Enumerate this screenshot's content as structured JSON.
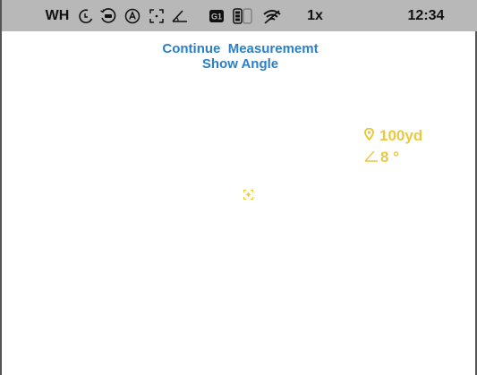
{
  "status_bar": {
    "mode_label": "WH",
    "zoom": "1x",
    "time": "12:34",
    "icons": [
      "night-mode-icon",
      "timer-icon",
      "auto-icon",
      "frame-icon",
      "angle-icon",
      "g1-profile-icon",
      "battery-icon",
      "wifi-icon"
    ]
  },
  "menu": {
    "line1": "Continue  Measurememt",
    "line2": "Show Angle"
  },
  "readout": {
    "distance": "100yd",
    "angle": "8 °"
  },
  "colors": {
    "status_bar_bg": "#b8b8b8",
    "menu_text": "#2a7fc6",
    "readout": "#e8c93f"
  }
}
